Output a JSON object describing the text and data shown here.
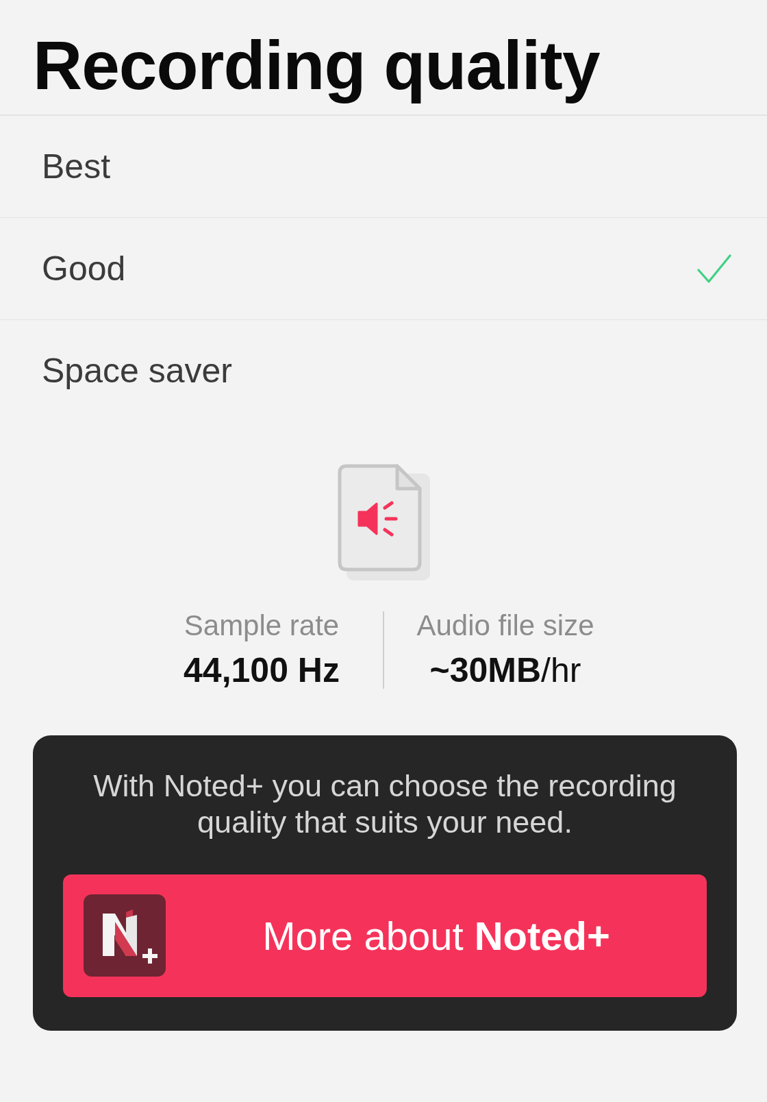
{
  "header": {
    "title": "Recording quality"
  },
  "options": [
    {
      "label": "Best",
      "selected": false
    },
    {
      "label": "Good",
      "selected": true
    },
    {
      "label": "Space saver",
      "selected": false
    }
  ],
  "stats": [
    {
      "label": "Sample rate",
      "value": "44,100 Hz"
    },
    {
      "label": "Audio file size",
      "value": "~30MB",
      "unit": "/hr"
    }
  ],
  "promo": {
    "text": "With Noted+ you can choose the recording quality that suits your need.",
    "button": "More about **Noted+**"
  }
}
